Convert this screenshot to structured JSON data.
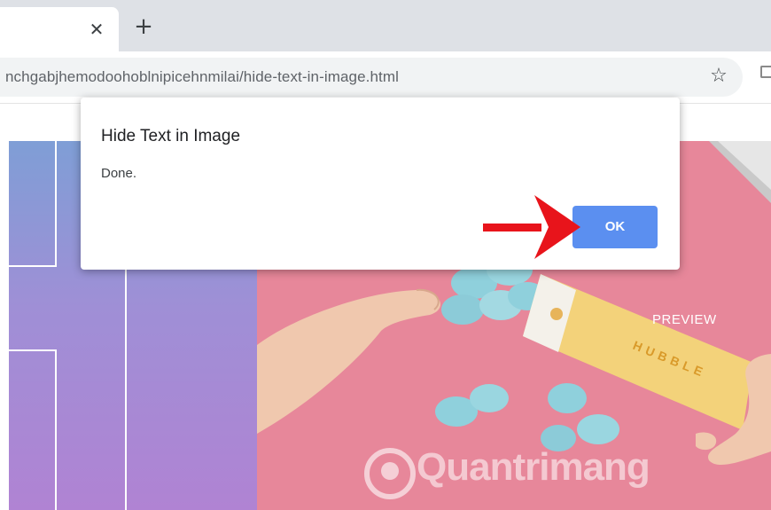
{
  "browser": {
    "tab_close_glyph": "✕",
    "new_tab_glyph": "+",
    "url": "nchgabjhemodoohoblnipicehnmilai/hide-text-in-image.html",
    "bookmark_glyph": "☆"
  },
  "dialog": {
    "title": "Hide Text in Image",
    "message": "Done.",
    "ok_label": "OK"
  },
  "page": {
    "preview_label": "PREVIEW",
    "product_brand": "HUBBLE",
    "watermark": "Quantrimang"
  },
  "colors": {
    "ok_button": "#5b8ff0",
    "annotation_arrow": "#e8141b",
    "photo_background": "#e7879a"
  }
}
